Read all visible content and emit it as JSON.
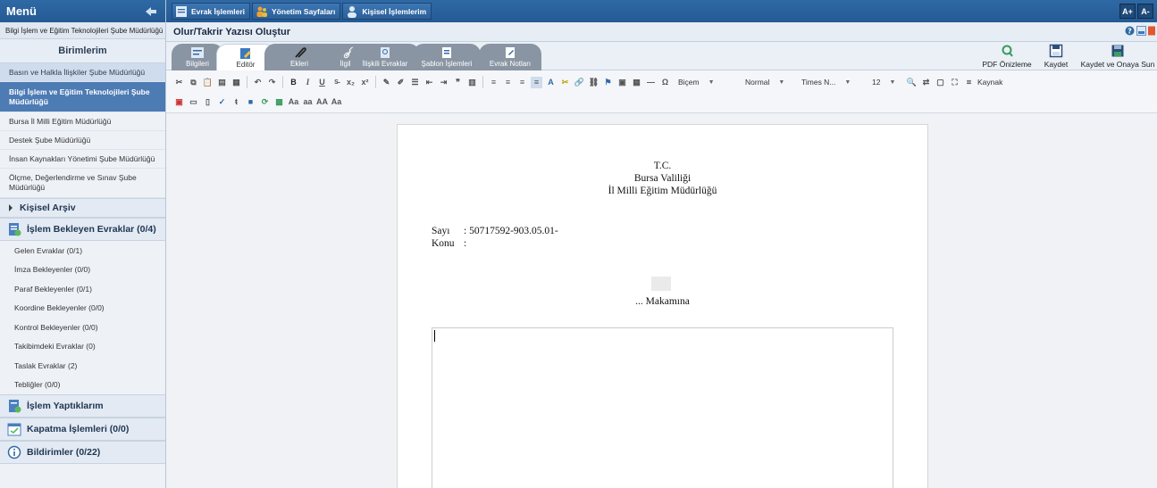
{
  "sidebar": {
    "title": "Menü",
    "subtitle": "Bilgi İşlem ve Eğitim Teknolojileri Şube Müdürlüğü",
    "units_title": "Birimlerim",
    "units": [
      {
        "label": "Basın ve Halkla İlişkiler Şube Müdürlüğü",
        "state": "hl"
      },
      {
        "label": "Bilgi İşlem ve Eğitim Teknolojileri Şube Müdürlüğü",
        "state": "sel"
      },
      {
        "label": "Bursa İl Milli Eğitim Müdürlüğü",
        "state": ""
      },
      {
        "label": "Destek Şube Müdürlüğü",
        "state": ""
      },
      {
        "label": "İnsan Kaynakları Yönetimi Şube Müdürlüğü",
        "state": ""
      },
      {
        "label": "Ölçme, Değerlendirme ve Sınav Şube Müdürlüğü",
        "state": ""
      }
    ],
    "archive": "Kişisel Arşiv",
    "pending_title": "İşlem Bekleyen Evraklar (0/4)",
    "pending_items": [
      "Gelen Evraklar (0/1)",
      "İmza Bekleyenler (0/0)",
      "Paraf Bekleyenler (0/1)",
      "Koordine Bekleyenler (0/0)",
      "Kontrol Bekleyenler (0/0)",
      "Takibimdeki Evraklar (0)",
      "Taslak Evraklar (2)",
      "Tebliğler (0/0)"
    ],
    "done": "İşlem Yaptıklarım",
    "closing": "Kapatma İşlemleri (0/0)",
    "notifications": "Bildirimler (0/22)"
  },
  "topbar": {
    "buttons": [
      "Evrak İşlemleri",
      "Yönetim Sayfaları",
      "Kişisel İşlemlerim"
    ],
    "font_up": "A+",
    "font_down": "A-"
  },
  "window_title": "Olur/Takrir Yazısı Oluştur",
  "tabs": [
    {
      "label": "Bilgileri",
      "active": false
    },
    {
      "label": "Editör",
      "active": true
    },
    {
      "label": "Ekleri",
      "active": false
    },
    {
      "label": "İlgileri",
      "active": false
    },
    {
      "label": "İlişkili Evraklar",
      "active": false
    },
    {
      "label": "Şablon İşlemleri",
      "active": false
    },
    {
      "label": "Evrak Notları",
      "active": false
    }
  ],
  "actions": {
    "pdf": "PDF Önizleme",
    "save": "Kaydet",
    "save_approve": "Kaydet ve Onaya Sun"
  },
  "toolbar": {
    "style_combo": "Biçem",
    "format_combo": "Normal",
    "font_combo": "Times N...",
    "size_combo": "12",
    "source": "Kaynak",
    "case_lower": "aa",
    "case_upper": "AA",
    "case_title": "Aa"
  },
  "document": {
    "line1": "T.C.",
    "line2": "Bursa Valiliği",
    "line3": "İl Milli Eğitim Müdürlüğü",
    "sayi_label": "Sayı",
    "sayi_value": ": 50717592-903.05.01-",
    "konu_label": "Konu",
    "konu_value": ":",
    "addressee": "... Makamına"
  },
  "colors": {
    "header": "#2f69a5",
    "selected": "#4d7bb4",
    "tab_inactive": "#8a95a3"
  }
}
